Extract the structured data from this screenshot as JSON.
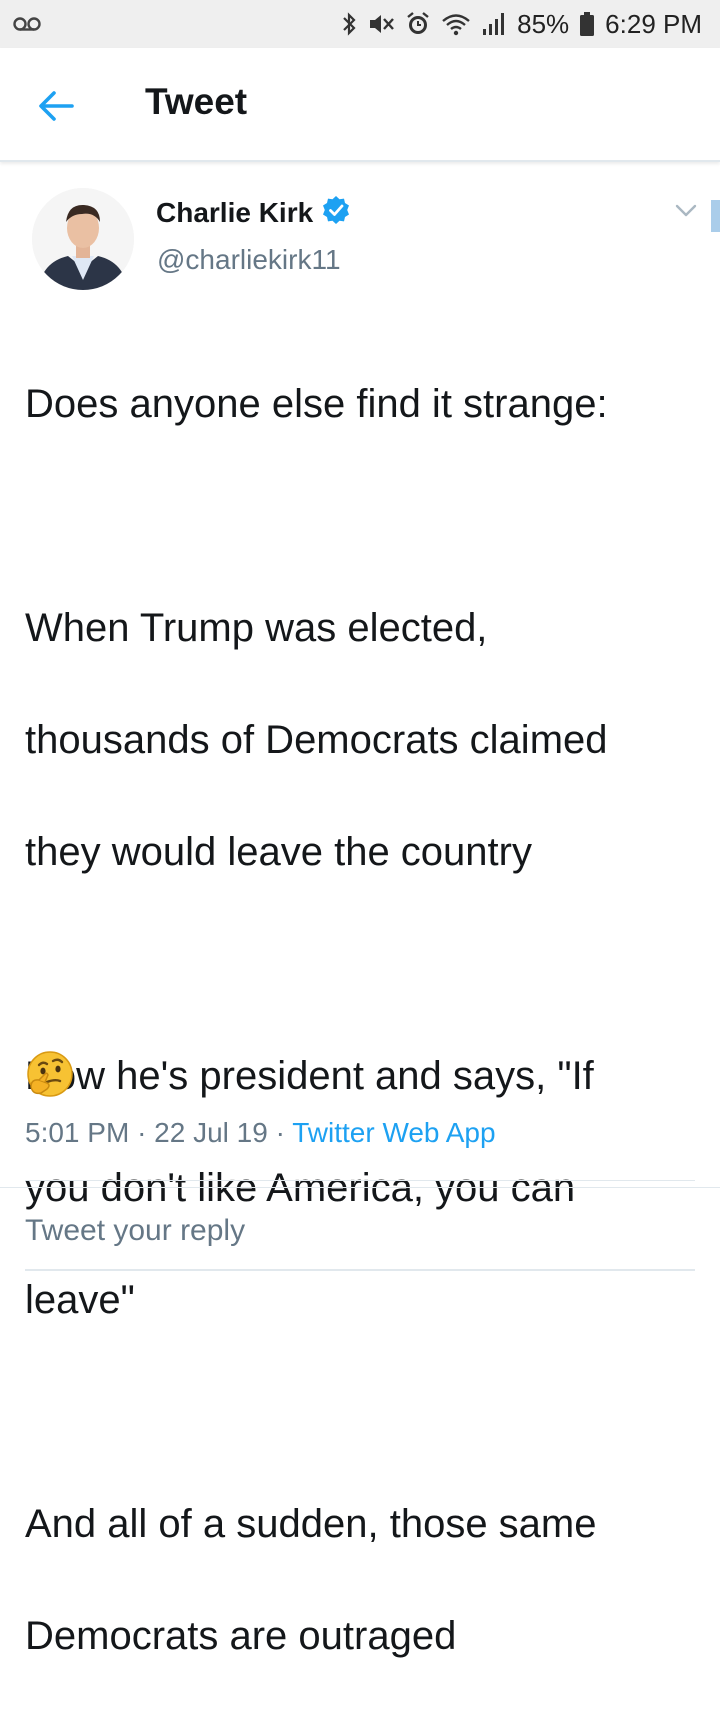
{
  "status_bar": {
    "battery": "85%",
    "time": "6:29 PM"
  },
  "header": {
    "title": "Tweet"
  },
  "tweet": {
    "author_name": "Charlie Kirk",
    "handle": "@charliekirk11",
    "verified": true,
    "lines": [
      "Does anyone else find it strange:",
      "",
      "When Trump was elected,",
      "thousands of Democrats claimed",
      "they would leave the country",
      "",
      "Now he's president and says, \"If",
      "you don't like America, you can",
      "leave\"",
      "",
      "And all of a sudden, those same",
      "Democrats are outraged"
    ],
    "emoji": "thinking-face",
    "time": "5:01 PM",
    "separator": "·",
    "date": "22 Jul 19",
    "source": "Twitter Web App"
  },
  "reply": {
    "placeholder": "Tweet your reply"
  },
  "colors": {
    "accent": "#1da1f2",
    "secondary_text": "#657786",
    "verified": "#1da1f2"
  }
}
